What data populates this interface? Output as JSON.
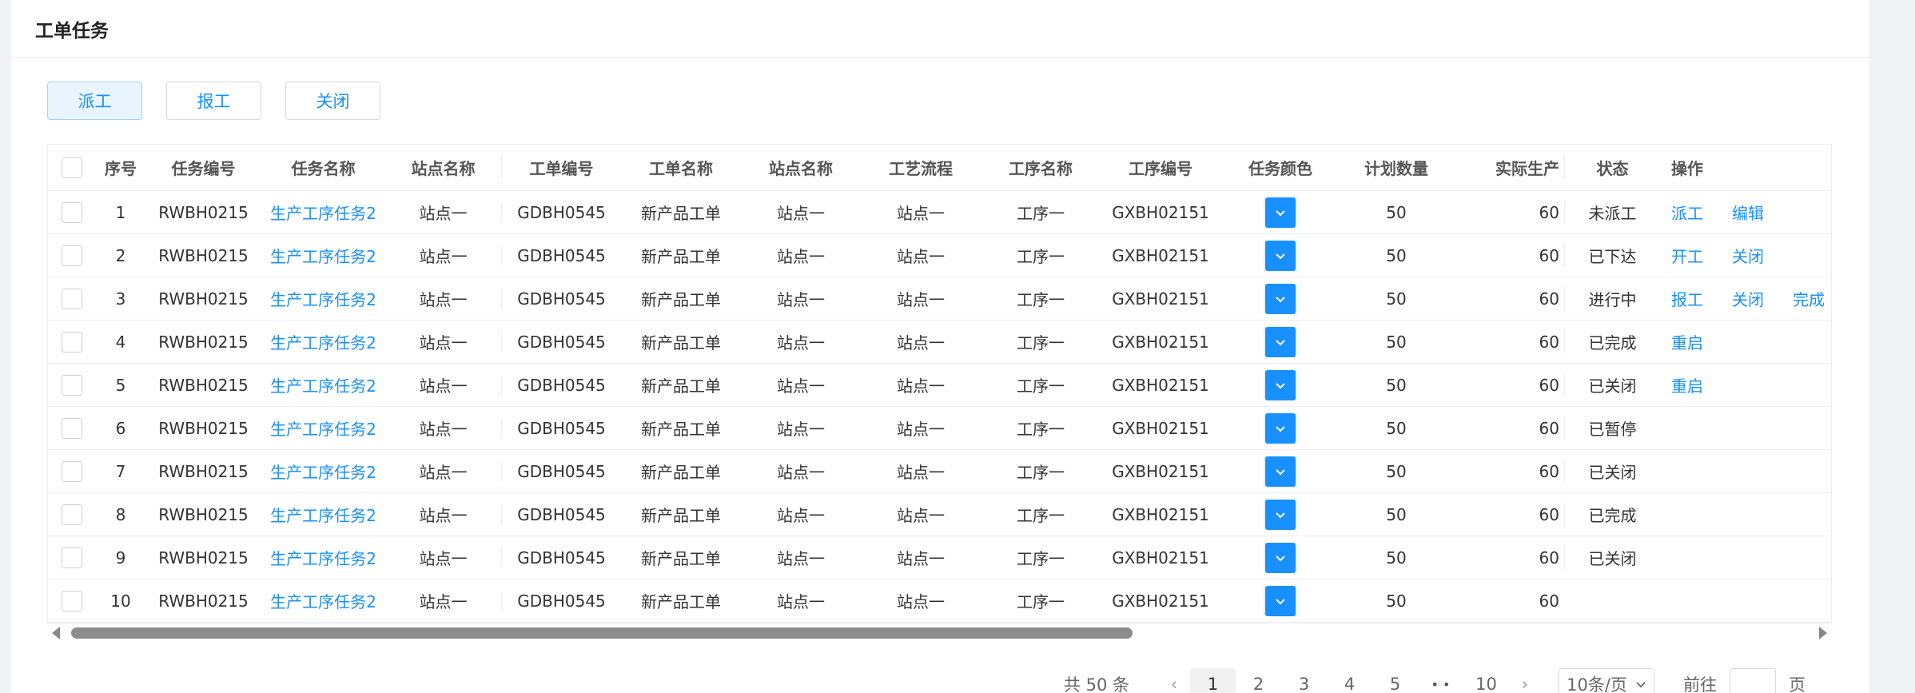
{
  "page": {
    "title": "工单任务"
  },
  "toolbar": {
    "dispatch": "派工",
    "report": "报工",
    "close": "关闭"
  },
  "columns": [
    "序号",
    "任务编号",
    "任务名称",
    "站点名称",
    "工单编号",
    "工单名称",
    "站点名称",
    "工艺流程",
    "工序名称",
    "工序编号",
    "任务颜色",
    "计划数量",
    "实际生产",
    "状态",
    "操作"
  ],
  "rows": [
    {
      "no": "1",
      "task_code": "RWBH0215",
      "task_name": "生产工序任务2",
      "site": "站点一",
      "wo_code": "GDBH0545",
      "wo_name": "新产品工单",
      "site2": "站点一",
      "process": "站点一",
      "step_name": "工序一",
      "step_code": "GXBH02151",
      "plan": "50",
      "actual": "60",
      "status": "未派工",
      "ops": [
        "派工",
        "编辑"
      ]
    },
    {
      "no": "2",
      "task_code": "RWBH0215",
      "task_name": "生产工序任务2",
      "site": "站点一",
      "wo_code": "GDBH0545",
      "wo_name": "新产品工单",
      "site2": "站点一",
      "process": "站点一",
      "step_name": "工序一",
      "step_code": "GXBH02151",
      "plan": "50",
      "actual": "60",
      "status": "已下达",
      "ops": [
        "开工",
        "关闭"
      ]
    },
    {
      "no": "3",
      "task_code": "RWBH0215",
      "task_name": "生产工序任务2",
      "site": "站点一",
      "wo_code": "GDBH0545",
      "wo_name": "新产品工单",
      "site2": "站点一",
      "process": "站点一",
      "step_name": "工序一",
      "step_code": "GXBH02151",
      "plan": "50",
      "actual": "60",
      "status": "进行中",
      "ops": [
        "报工",
        "关闭",
        "完成"
      ]
    },
    {
      "no": "4",
      "task_code": "RWBH0215",
      "task_name": "生产工序任务2",
      "site": "站点一",
      "wo_code": "GDBH0545",
      "wo_name": "新产品工单",
      "site2": "站点一",
      "process": "站点一",
      "step_name": "工序一",
      "step_code": "GXBH02151",
      "plan": "50",
      "actual": "60",
      "status": "已完成",
      "ops": [
        "重启"
      ]
    },
    {
      "no": "5",
      "task_code": "RWBH0215",
      "task_name": "生产工序任务2",
      "site": "站点一",
      "wo_code": "GDBH0545",
      "wo_name": "新产品工单",
      "site2": "站点一",
      "process": "站点一",
      "step_name": "工序一",
      "step_code": "GXBH02151",
      "plan": "50",
      "actual": "60",
      "status": "已关闭",
      "ops": [
        "重启"
      ]
    },
    {
      "no": "6",
      "task_code": "RWBH0215",
      "task_name": "生产工序任务2",
      "site": "站点一",
      "wo_code": "GDBH0545",
      "wo_name": "新产品工单",
      "site2": "站点一",
      "process": "站点一",
      "step_name": "工序一",
      "step_code": "GXBH02151",
      "plan": "50",
      "actual": "60",
      "status": "已暂停",
      "ops": []
    },
    {
      "no": "7",
      "task_code": "RWBH0215",
      "task_name": "生产工序任务2",
      "site": "站点一",
      "wo_code": "GDBH0545",
      "wo_name": "新产品工单",
      "site2": "站点一",
      "process": "站点一",
      "step_name": "工序一",
      "step_code": "GXBH02151",
      "plan": "50",
      "actual": "60",
      "status": "已关闭",
      "ops": []
    },
    {
      "no": "8",
      "task_code": "RWBH0215",
      "task_name": "生产工序任务2",
      "site": "站点一",
      "wo_code": "GDBH0545",
      "wo_name": "新产品工单",
      "site2": "站点一",
      "process": "站点一",
      "step_name": "工序一",
      "step_code": "GXBH02151",
      "plan": "50",
      "actual": "60",
      "status": "已完成",
      "ops": []
    },
    {
      "no": "9",
      "task_code": "RWBH0215",
      "task_name": "生产工序任务2",
      "site": "站点一",
      "wo_code": "GDBH0545",
      "wo_name": "新产品工单",
      "site2": "站点一",
      "process": "站点一",
      "step_name": "工序一",
      "step_code": "GXBH02151",
      "plan": "50",
      "actual": "60",
      "status": "已关闭",
      "ops": []
    },
    {
      "no": "10",
      "task_code": "RWBH0215",
      "task_name": "生产工序任务2",
      "site": "站点一",
      "wo_code": "GDBH0545",
      "wo_name": "新产品工单",
      "site2": "站点一",
      "process": "站点一",
      "step_name": "工序一",
      "step_code": "GXBH02151",
      "plan": "50",
      "actual": "60",
      "status": "",
      "ops": []
    }
  ],
  "pagination": {
    "total": "共 50 条",
    "prev": "‹",
    "next": "›",
    "pages": [
      "1",
      "2",
      "3",
      "4",
      "5"
    ],
    "ellipsis": "•  •",
    "last": "10",
    "current": "1",
    "page_size": "10条/页",
    "goto_label": "前往",
    "page_suffix": "页"
  },
  "icons": {
    "color_picker": "chevron-down-icon"
  },
  "colors": {
    "accent": "#1890ff",
    "task_color": "#1890ff"
  }
}
